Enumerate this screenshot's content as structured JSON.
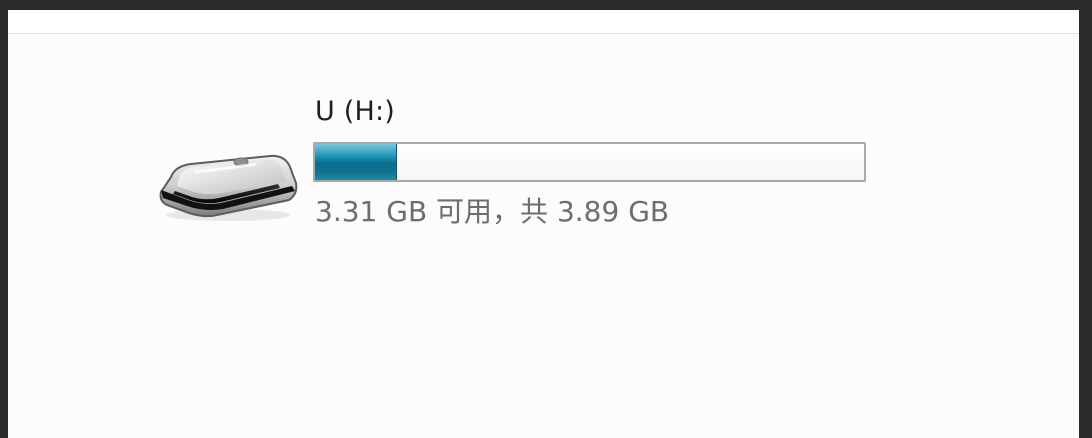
{
  "drive": {
    "icon": "usb-drive-icon",
    "name": "U (H:)",
    "capacity_text": "3.31 GB 可用，共 3.89 GB",
    "used_fraction": 0.15,
    "bar_colors": {
      "fill": "#1e94b5",
      "fill_dark": "#0a6f90",
      "border": "#a9a9a9"
    }
  }
}
